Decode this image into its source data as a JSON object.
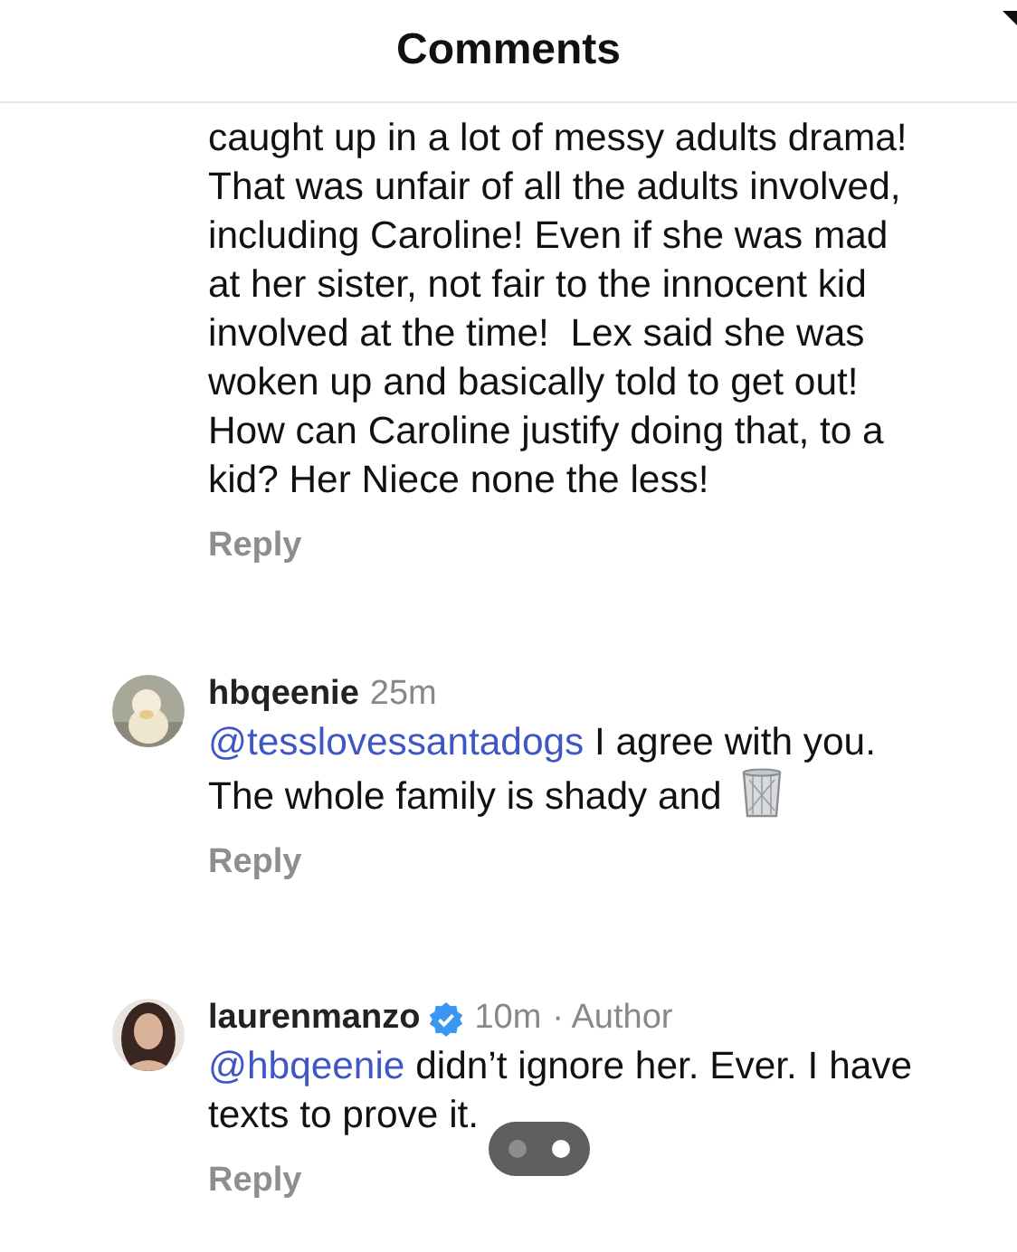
{
  "header": {
    "title": "Comments"
  },
  "comments": [
    {
      "kind": "continued",
      "text": "caught up in a lot of messy adults drama!  That was unfair of all the adults involved, including Caroline! Even if she was mad at her sister, not fair to the innocent kid involved at the time!  Lex said she was woken up and basically told to get out!  How can Caroline justify doing that, to a kid? Her Niece none the less!",
      "reply": "Reply"
    },
    {
      "kind": "full",
      "username": "hbqeenie",
      "time": "25m",
      "mention": "@tesslovessantadogs",
      "text": "I agree with you. The whole family is shady and",
      "trash_emoji": true,
      "reply": "Reply"
    },
    {
      "kind": "full",
      "username": "laurenmanzo",
      "verified": true,
      "time": "10m",
      "role": "· Author",
      "mention": "@hbqeenie",
      "text": "didn’t ignore her. Ever. I have texts to prove it.",
      "reply": "Reply"
    }
  ],
  "page_indicator": [
    {
      "selected": false
    },
    {
      "selected": true
    }
  ]
}
